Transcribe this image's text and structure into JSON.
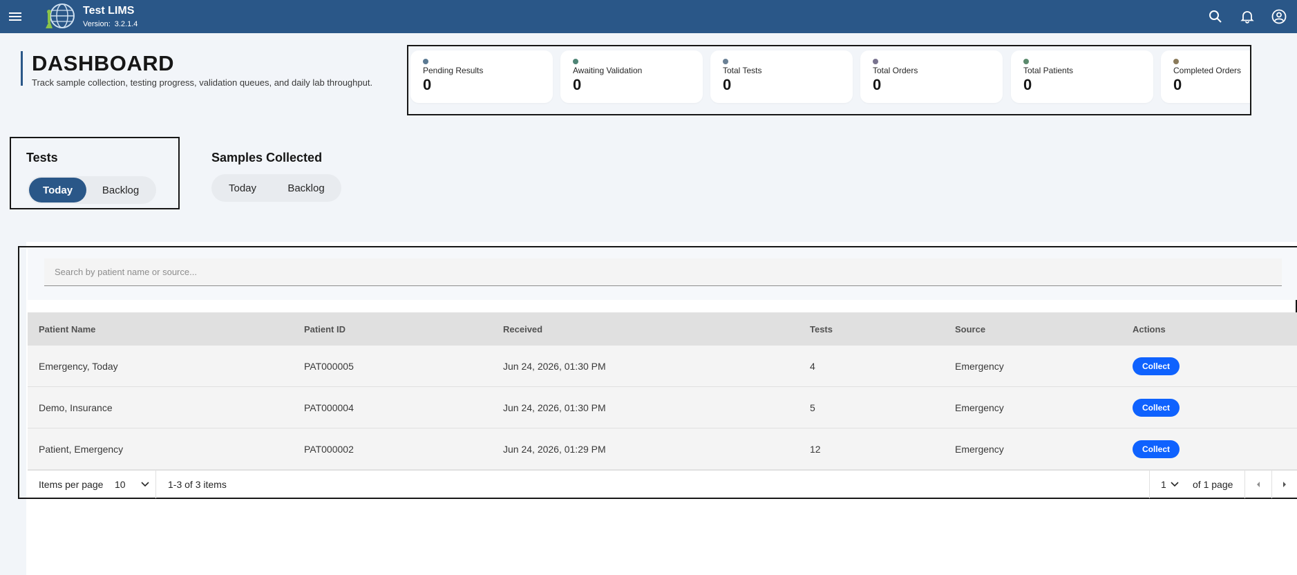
{
  "app": {
    "title": "Test LIMS",
    "version_label": "Version:",
    "version": "3.2.1.4",
    "brand_color": "#2a5788"
  },
  "header_icons": [
    "search-icon",
    "notification-bell-icon",
    "user-avatar-icon"
  ],
  "page": {
    "title": "DASHBOARD",
    "subtitle": "Track sample collection, testing progress, validation queues, and daily lab throughput."
  },
  "stats": [
    {
      "label": "Pending Results",
      "value": "0",
      "dot_color": "#5b7a93"
    },
    {
      "label": "Awaiting Validation",
      "value": "0",
      "dot_color": "#4f8576"
    },
    {
      "label": "Total Tests",
      "value": "0",
      "dot_color": "#6a8095"
    },
    {
      "label": "Total Orders",
      "value": "0",
      "dot_color": "#79738f"
    },
    {
      "label": "Total Patients",
      "value": "0",
      "dot_color": "#5b8a6d"
    },
    {
      "label": "Completed Orders",
      "value": "0",
      "dot_color": "#8a7a5a"
    }
  ],
  "tests_toggle": {
    "title": "Tests",
    "options": [
      "Today",
      "Backlog"
    ],
    "selected": "Today"
  },
  "samples_toggle": {
    "title": "Samples Collected",
    "options": [
      "Today",
      "Backlog"
    ],
    "selected": ""
  },
  "search": {
    "placeholder": "Search by patient name or source...",
    "value": ""
  },
  "table": {
    "columns": [
      "Patient Name",
      "Patient ID",
      "Received",
      "Tests",
      "Source",
      "Actions"
    ],
    "rows": [
      {
        "name": "Emergency, Today",
        "id": "PAT000005",
        "received": "Jun 24, 2026, 01:30 PM",
        "tests": "4",
        "source": "Emergency",
        "action": "Collect"
      },
      {
        "name": "Demo, Insurance",
        "id": "PAT000004",
        "received": "Jun 24, 2026, 01:30 PM",
        "tests": "5",
        "source": "Emergency",
        "action": "Collect"
      },
      {
        "name": "Patient, Emergency",
        "id": "PAT000002",
        "received": "Jun 24, 2026, 01:29 PM",
        "tests": "12",
        "source": "Emergency",
        "action": "Collect"
      }
    ]
  },
  "pagination": {
    "items_per_page_label": "Items per page",
    "items_per_page": "10",
    "range": "1-3 of 3 items",
    "page": "1",
    "of_pages": "of 1 page"
  }
}
